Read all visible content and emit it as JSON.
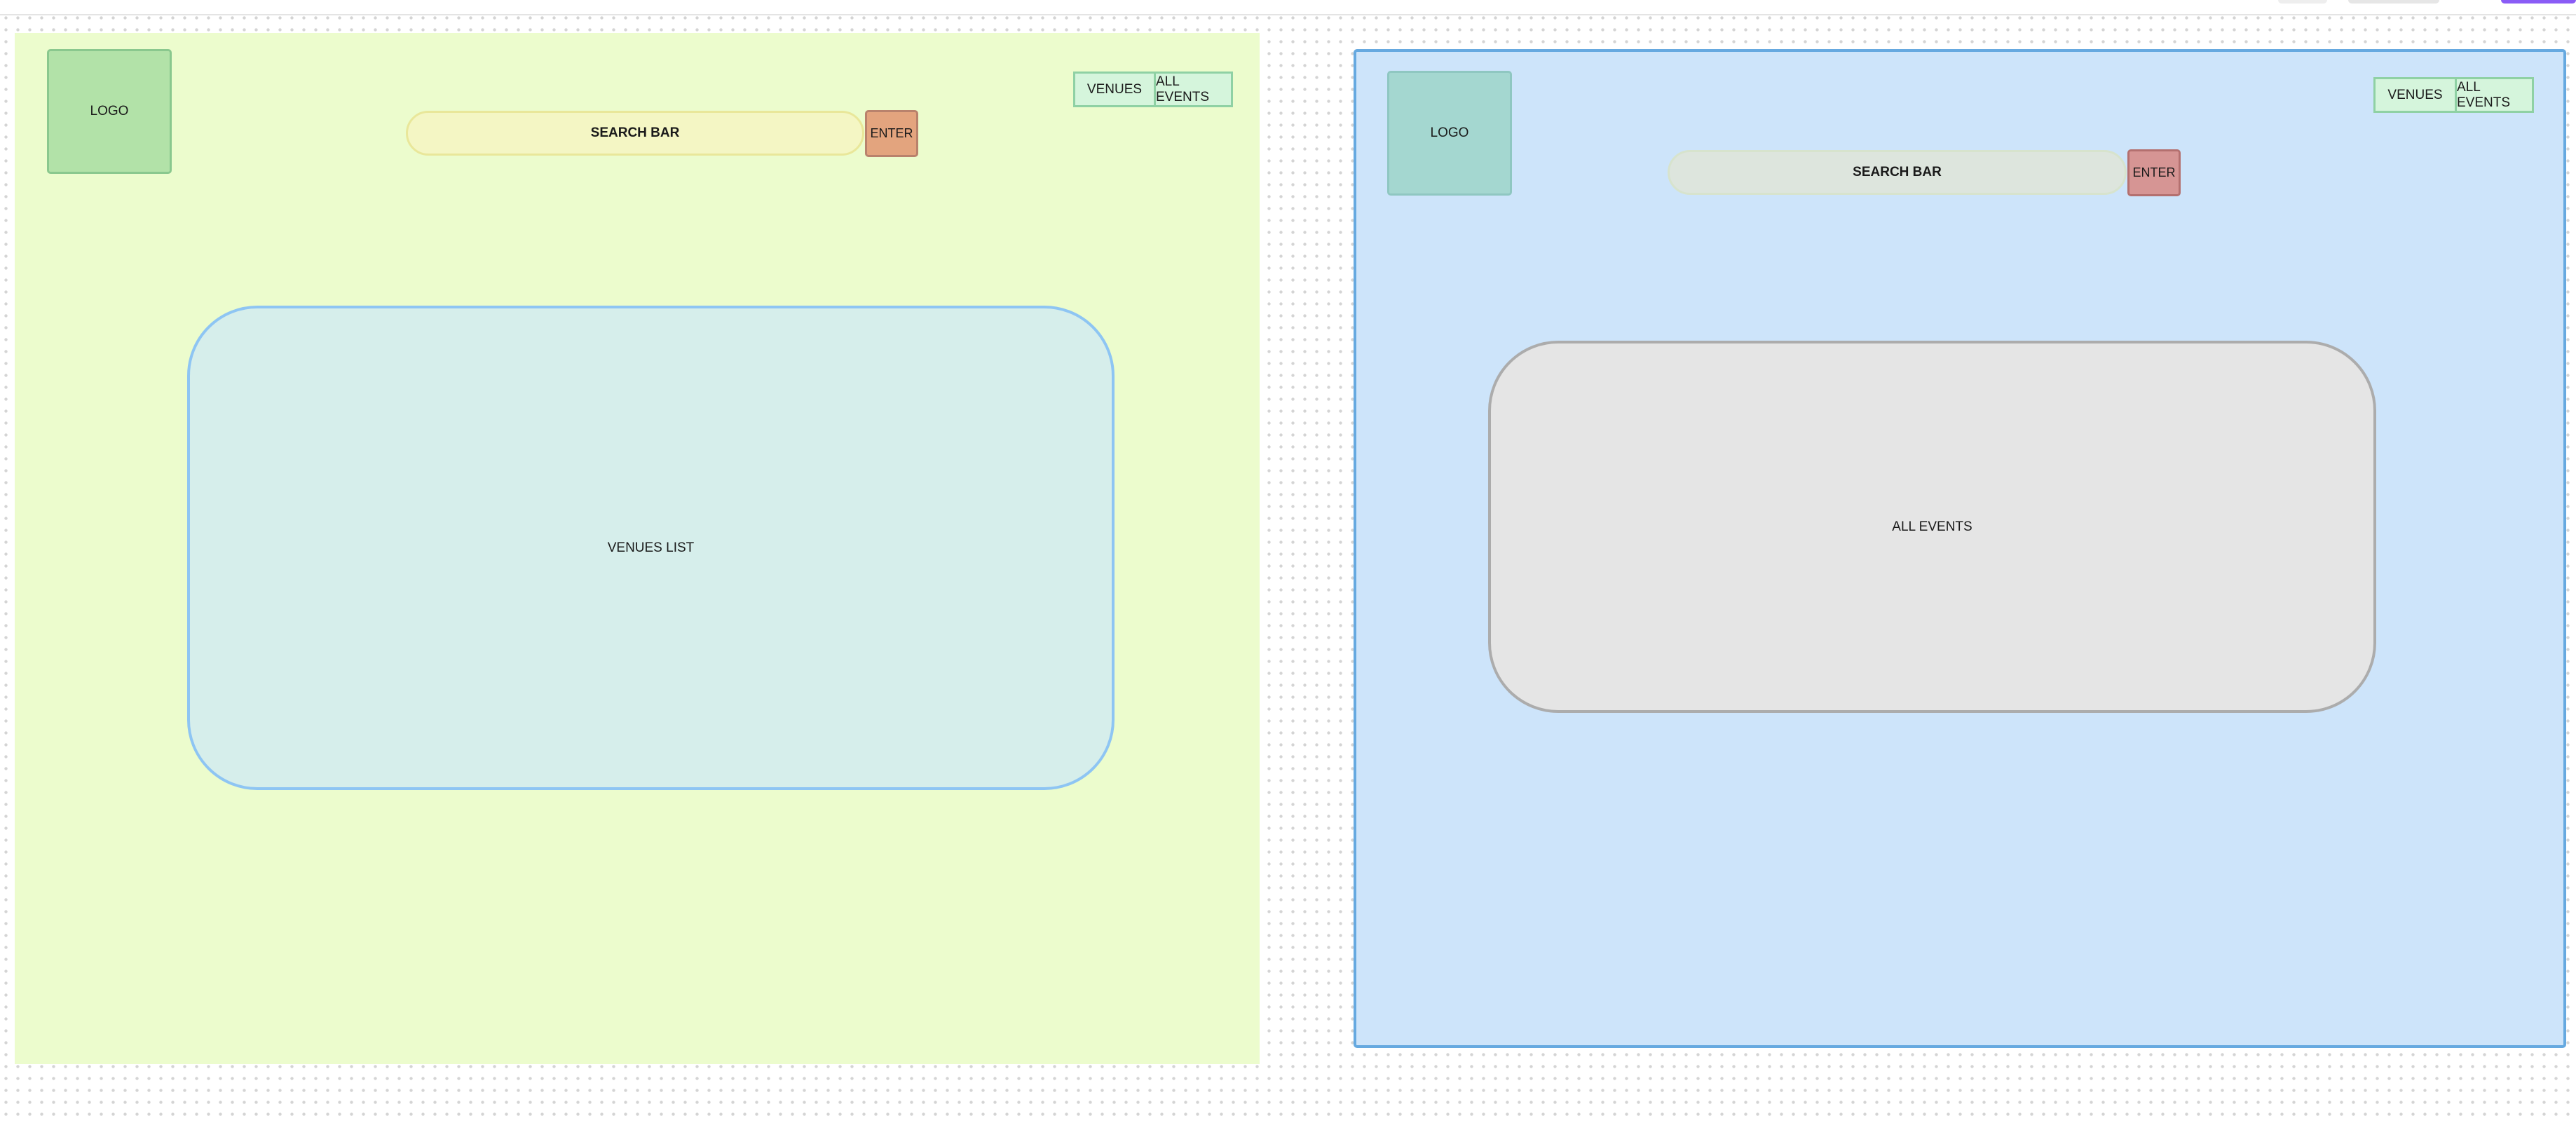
{
  "wireframes": [
    {
      "logo": "LOGO",
      "search_bar": "SEARCH BAR",
      "enter_button": "ENTER",
      "nav": {
        "venues": "VENUES",
        "all_events": "ALL EVENTS"
      },
      "content_panel": "VENUES LIST"
    },
    {
      "logo": "LOGO",
      "search_bar": "SEARCH BAR",
      "enter_button": "ENTER",
      "nav": {
        "venues": "VENUES",
        "all_events": "ALL EVENTS"
      },
      "content_panel": "ALL EVENTS"
    }
  ],
  "colors": {
    "canvas": "#ffffff",
    "wireframe_a_background": "#ecfccd",
    "wireframe_b_background": "#cde4fa",
    "wireframe_b_border": "#66a9e0",
    "logo_a": "#b2e2a8",
    "logo_b": "#a4d7d0",
    "search_a": "#f4f6c4",
    "search_b": "#dde5dd",
    "enter_a": "#e3a47e",
    "enter_b": "#d69594",
    "nav_fill": "#d5f5dc",
    "panel_a_fill": "#d6eeeb",
    "panel_a_border": "#8ec5f3",
    "panel_b_fill": "#e5e5e5",
    "panel_b_border": "#acacac"
  }
}
